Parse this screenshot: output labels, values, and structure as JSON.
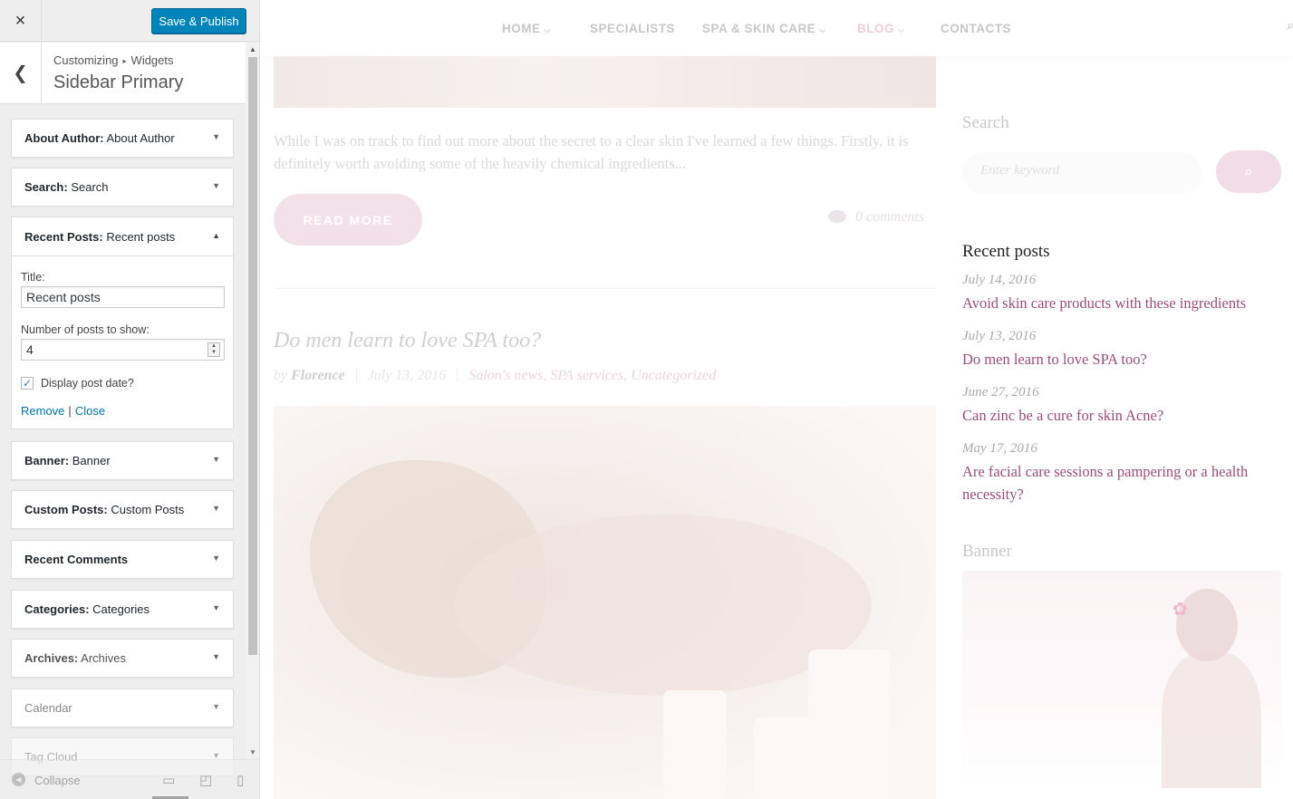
{
  "customizer": {
    "close_icon": "×",
    "publish_label": "Save & Publish",
    "back_icon": "‹",
    "breadcrumb": {
      "root": "Customizing",
      "sep": "▸",
      "current": "Widgets"
    },
    "title": "Sidebar Primary",
    "widgets_before": [
      {
        "type": "About Author:",
        "name": "About Author"
      },
      {
        "type": "Search:",
        "name": "Search"
      }
    ],
    "open_widget": {
      "type": "Recent Posts:",
      "name": "Recent posts",
      "title_label": "Title:",
      "title_value": "Recent posts",
      "number_label": "Number of posts to show:",
      "number_value": "4",
      "show_date_label": "Display post date?",
      "show_date_checked": true,
      "remove_label": "Remove",
      "close_label": "Close"
    },
    "widgets_after": [
      {
        "type": "Banner:",
        "name": "Banner"
      },
      {
        "type": "Custom Posts:",
        "name": "Custom Posts"
      },
      {
        "type": "Recent Comments",
        "name": ""
      },
      {
        "type": "Categories:",
        "name": "Categories"
      },
      {
        "type": "Archives:",
        "name": "Archives"
      },
      {
        "type": "",
        "name": "Calendar"
      },
      {
        "type": "",
        "name": "Tag Cloud"
      }
    ],
    "footer": {
      "collapse_label": "Collapse"
    }
  },
  "site": {
    "nav": [
      {
        "label": "HOME",
        "dropdown": true
      },
      {
        "label": "SPECIALISTS",
        "dropdown": false
      },
      {
        "label": "SPA & SKIN CARE",
        "dropdown": true
      },
      {
        "label": "BLOG",
        "dropdown": true
      },
      {
        "label": "CONTACTS",
        "dropdown": false
      }
    ],
    "active_nav": "BLOG",
    "excerpt": "While I was on track to find out more about the secret to a clear skin I've learned a few things. Firstly, it is definitely worth avoiding some of the heavily chemical ingredients...",
    "read_more": "READ MORE",
    "comments": "0 comments",
    "post": {
      "title": "Do men learn to love SPA too?",
      "by": "by",
      "author": "Florence",
      "date": "July 13, 2016",
      "categories": "Salon's news, SPA services, Uncategorized"
    },
    "sidebar": {
      "search_heading": "Search",
      "search_placeholder": "Enter keyword",
      "recent_heading": "Recent posts",
      "recent_posts": [
        {
          "date": "July 14, 2016",
          "title": "Avoid skin care products with these ingredients"
        },
        {
          "date": "July 13, 2016",
          "title": "Do men learn to love SPA too?"
        },
        {
          "date": "June 27, 2016",
          "title": "Can zinc be a cure for skin Acne?"
        },
        {
          "date": "May 17, 2016",
          "title": "Are facial care sessions a pampering or a health necessity?"
        }
      ],
      "banner_heading": "Banner"
    }
  },
  "colors": {
    "primary_button": "#0085ba",
    "accent_link": "#9a4f76",
    "pink_soft": "#f1dde6"
  }
}
